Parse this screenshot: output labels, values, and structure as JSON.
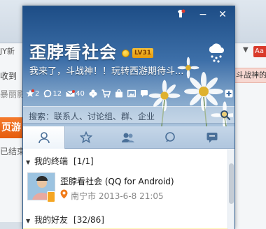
{
  "background": {
    "left_fragments": [
      "JY新",
      "收到",
      "暴丽影",
      "页游",
      "已结束"
    ],
    "right_fragments": [
      "斗战神的"
    ],
    "right_badge": "Aa"
  },
  "window_controls": {
    "minimize": "−",
    "close": "✕"
  },
  "profile": {
    "name": "歪脖看社会",
    "level": "LV31",
    "signature": "我来了，斗战神！！玩转西游期待斗..."
  },
  "icon_bar": {
    "items": [
      {
        "icon": "star-icon",
        "count": "2"
      },
      {
        "icon": "bubble-icon",
        "count": "12"
      },
      {
        "icon": "mail-icon",
        "count": "40"
      },
      {
        "icon": "clover-icon",
        "count": ""
      },
      {
        "icon": "cart-icon",
        "count": ""
      },
      {
        "icon": "bag-icon",
        "count": ""
      },
      {
        "icon": "photo-icon",
        "count": ""
      },
      {
        "icon": "chat-icon",
        "count": ""
      },
      {
        "icon": "add-icon",
        "count": ""
      }
    ]
  },
  "search": {
    "placeholder": "搜索：联系人、讨论组、群、企业"
  },
  "tabs": [
    {
      "icon": "contacts-icon"
    },
    {
      "icon": "favorites-icon"
    },
    {
      "icon": "groups-icon"
    },
    {
      "icon": "recent-icon"
    },
    {
      "icon": "messages-icon"
    }
  ],
  "list": {
    "groups": [
      {
        "label": "我的终端",
        "count": "[1/1]"
      },
      {
        "label": "我的好友",
        "count": "[32/86]"
      }
    ],
    "contact": {
      "name": "歪脖看社会 (QQ for Android)",
      "location": "南宁市  2013-6-8 21:05"
    }
  },
  "colors": {
    "header_top": "#1d4d86",
    "header_bottom": "#a9c3dc",
    "location_pin": "#f07b1a"
  }
}
